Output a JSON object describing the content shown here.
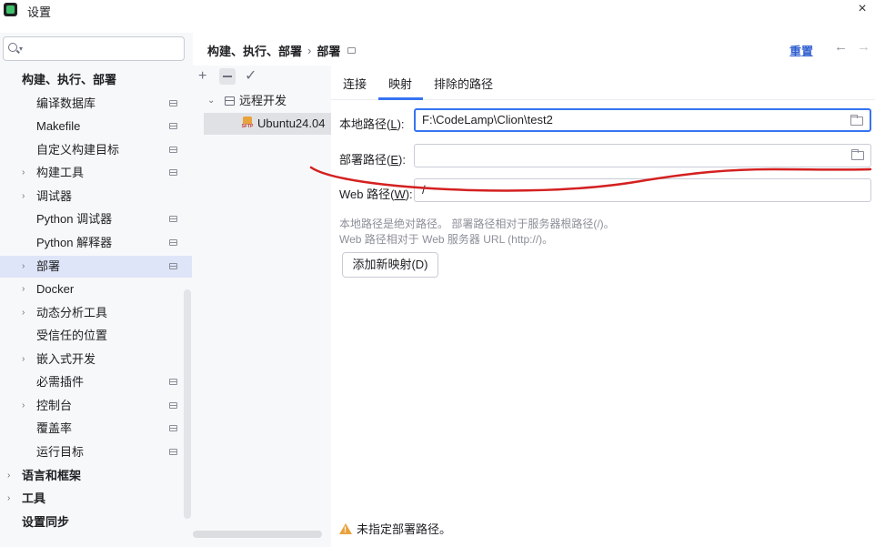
{
  "window": {
    "title": "设置",
    "close_glyph": "×"
  },
  "search": {
    "placeholder": ""
  },
  "sidebar": {
    "items": [
      {
        "label": "构建、执行、部署",
        "bold": true
      },
      {
        "label": "编译数据库"
      },
      {
        "label": "Makefile"
      },
      {
        "label": "自定义构建目标"
      },
      {
        "label": "构建工具"
      },
      {
        "label": "调试器"
      },
      {
        "label": "Python 调试器"
      },
      {
        "label": "Python 解释器"
      },
      {
        "label": "部署"
      },
      {
        "label": "Docker"
      },
      {
        "label": "动态分析工具"
      },
      {
        "label": "受信任的位置"
      },
      {
        "label": "嵌入式开发"
      },
      {
        "label": "必需插件"
      },
      {
        "label": "控制台"
      },
      {
        "label": "覆盖率"
      },
      {
        "label": "运行目标"
      },
      {
        "label": "语言和框架",
        "bold": true
      },
      {
        "label": "工具",
        "bold": true
      },
      {
        "label": "设置同步",
        "bold": true
      }
    ]
  },
  "breadcrumb": {
    "parent": "构建、执行、部署",
    "separator": "›",
    "current": "部署"
  },
  "header": {
    "reset": "重置",
    "back": "←",
    "forward": "→"
  },
  "deployment": {
    "toolbar": {
      "add": "+",
      "apply": "✓"
    },
    "group": "远程开发",
    "server": "Ubuntu24.04",
    "server_icon_text": "SFTP"
  },
  "tabs": [
    {
      "label": "连接"
    },
    {
      "label": "映射",
      "active": true
    },
    {
      "label": "排除的路径"
    }
  ],
  "mapping": {
    "local_path": {
      "label_pre": "本地路径(",
      "mnemonic": "L",
      "label_post": "):",
      "value": "F:\\CodeLamp\\Clion\\test2"
    },
    "deployment_path": {
      "label_pre": "部署路径(",
      "mnemonic": "E",
      "label_post": "):",
      "value": ""
    },
    "web_path": {
      "label_pre": "Web 路径(",
      "mnemonic": "W",
      "label_post": "):",
      "value": "/"
    },
    "hint_line1": "本地路径是绝对路径。 部署路径相对于服务器根路径(/)。",
    "hint_line2": "Web 路径相对于 Web 服务器 URL (http://)。",
    "add_mapping_button": "添加新映射(D)"
  },
  "warning": {
    "text": "未指定部署路径。"
  },
  "colors": {
    "accent": "#3574f0",
    "link": "#2f5fd0",
    "selection": "#dfe5f8",
    "annotation": "#d42020"
  }
}
